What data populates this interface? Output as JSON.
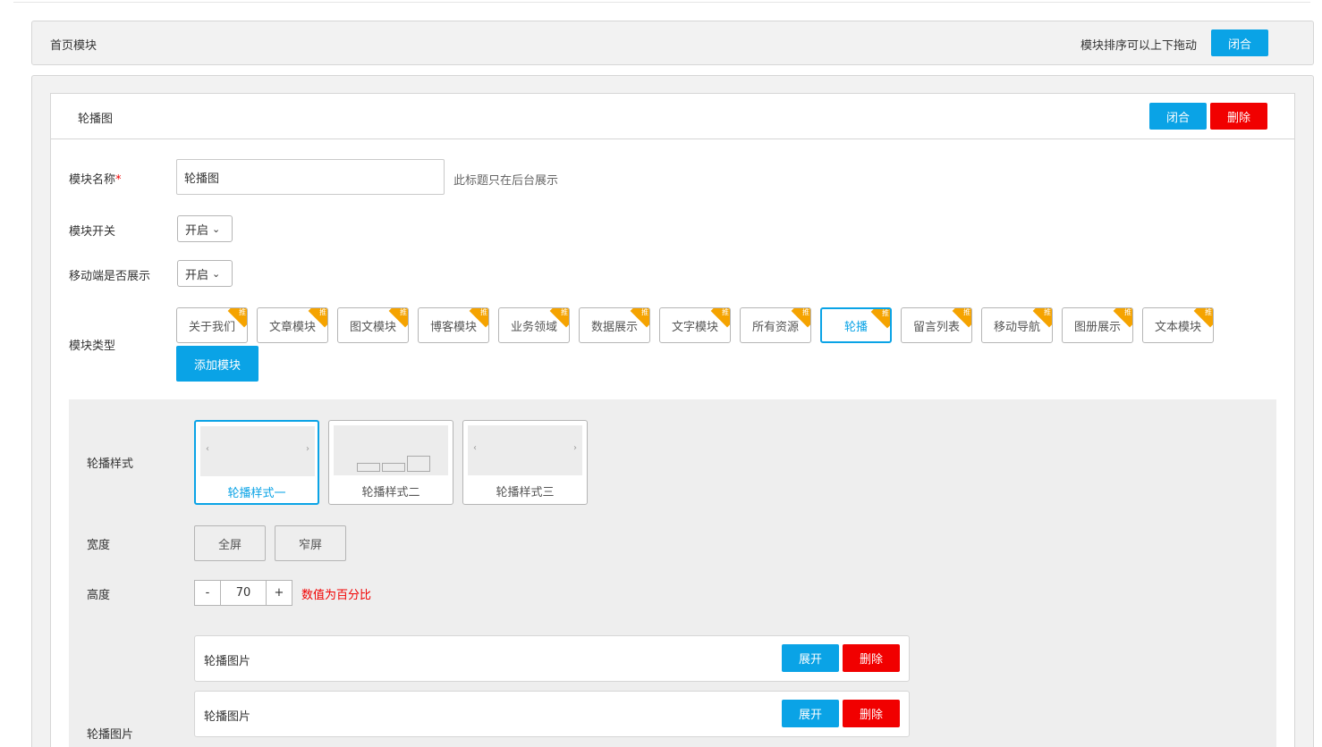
{
  "home": {
    "title": "首页模块",
    "sort_hint": "模块排序可以上下拖动",
    "collapse_label": "闭合"
  },
  "module": {
    "title": "轮播图",
    "collapse_label": "闭合",
    "delete_label": "删除",
    "name_label": "模块名称",
    "name_required": "*",
    "name_value": "轮播图",
    "name_hint": "此标题只在后台展示",
    "switch_label": "模块开关",
    "switch_value": "开启",
    "mobile_label": "移动端是否展示",
    "mobile_value": "开启",
    "type_label": "模块类型",
    "types": [
      "关于我们",
      "文章模块",
      "图文模块",
      "博客模块",
      "业务领域",
      "数据展示",
      "文字模块",
      "所有资源",
      "轮播",
      "留言列表",
      "移动导航",
      "图册展示",
      "文本模块"
    ],
    "active_type": "轮播",
    "corner_badge": "推",
    "add_label": "添加模块"
  },
  "carousel": {
    "style_label": "轮播样式",
    "styles": [
      "轮播样式一",
      "轮播样式二",
      "轮播样式三"
    ],
    "width_label": "宽度",
    "width_options": [
      "全屏",
      "窄屏"
    ],
    "height_label": "高度",
    "height_minus": "-",
    "height_value": "70",
    "height_plus": "+",
    "height_hint": "数值为百分比",
    "images_label": "轮播图片",
    "image_rows": [
      {
        "title": "轮播图片",
        "expand": "展开",
        "delete": "删除"
      },
      {
        "title": "轮播图片",
        "expand": "展开",
        "delete": "删除"
      }
    ]
  },
  "colors": {
    "primary": "#0aa3e6",
    "danger": "#f10000",
    "badge": "#f5a300"
  }
}
